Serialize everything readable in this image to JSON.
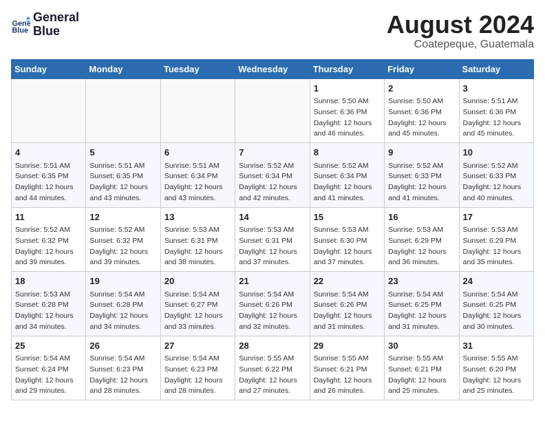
{
  "logo": {
    "line1": "General",
    "line2": "Blue"
  },
  "title": {
    "month_year": "August 2024",
    "location": "Coatepeque, Guatemala"
  },
  "days_of_week": [
    "Sunday",
    "Monday",
    "Tuesday",
    "Wednesday",
    "Thursday",
    "Friday",
    "Saturday"
  ],
  "weeks": [
    [
      {
        "day": "",
        "content": ""
      },
      {
        "day": "",
        "content": ""
      },
      {
        "day": "",
        "content": ""
      },
      {
        "day": "",
        "content": ""
      },
      {
        "day": "1",
        "content": "Sunrise: 5:50 AM\nSunset: 6:36 PM\nDaylight: 12 hours\nand 46 minutes."
      },
      {
        "day": "2",
        "content": "Sunrise: 5:50 AM\nSunset: 6:36 PM\nDaylight: 12 hours\nand 45 minutes."
      },
      {
        "day": "3",
        "content": "Sunrise: 5:51 AM\nSunset: 6:36 PM\nDaylight: 12 hours\nand 45 minutes."
      }
    ],
    [
      {
        "day": "4",
        "content": "Sunrise: 5:51 AM\nSunset: 6:35 PM\nDaylight: 12 hours\nand 44 minutes."
      },
      {
        "day": "5",
        "content": "Sunrise: 5:51 AM\nSunset: 6:35 PM\nDaylight: 12 hours\nand 43 minutes."
      },
      {
        "day": "6",
        "content": "Sunrise: 5:51 AM\nSunset: 6:34 PM\nDaylight: 12 hours\nand 43 minutes."
      },
      {
        "day": "7",
        "content": "Sunrise: 5:52 AM\nSunset: 6:34 PM\nDaylight: 12 hours\nand 42 minutes."
      },
      {
        "day": "8",
        "content": "Sunrise: 5:52 AM\nSunset: 6:34 PM\nDaylight: 12 hours\nand 41 minutes."
      },
      {
        "day": "9",
        "content": "Sunrise: 5:52 AM\nSunset: 6:33 PM\nDaylight: 12 hours\nand 41 minutes."
      },
      {
        "day": "10",
        "content": "Sunrise: 5:52 AM\nSunset: 6:33 PM\nDaylight: 12 hours\nand 40 minutes."
      }
    ],
    [
      {
        "day": "11",
        "content": "Sunrise: 5:52 AM\nSunset: 6:32 PM\nDaylight: 12 hours\nand 39 minutes."
      },
      {
        "day": "12",
        "content": "Sunrise: 5:52 AM\nSunset: 6:32 PM\nDaylight: 12 hours\nand 39 minutes."
      },
      {
        "day": "13",
        "content": "Sunrise: 5:53 AM\nSunset: 6:31 PM\nDaylight: 12 hours\nand 38 minutes."
      },
      {
        "day": "14",
        "content": "Sunrise: 5:53 AM\nSunset: 6:31 PM\nDaylight: 12 hours\nand 37 minutes."
      },
      {
        "day": "15",
        "content": "Sunrise: 5:53 AM\nSunset: 6:30 PM\nDaylight: 12 hours\nand 37 minutes."
      },
      {
        "day": "16",
        "content": "Sunrise: 5:53 AM\nSunset: 6:29 PM\nDaylight: 12 hours\nand 36 minutes."
      },
      {
        "day": "17",
        "content": "Sunrise: 5:53 AM\nSunset: 6:29 PM\nDaylight: 12 hours\nand 35 minutes."
      }
    ],
    [
      {
        "day": "18",
        "content": "Sunrise: 5:53 AM\nSunset: 6:28 PM\nDaylight: 12 hours\nand 34 minutes."
      },
      {
        "day": "19",
        "content": "Sunrise: 5:54 AM\nSunset: 6:28 PM\nDaylight: 12 hours\nand 34 minutes."
      },
      {
        "day": "20",
        "content": "Sunrise: 5:54 AM\nSunset: 6:27 PM\nDaylight: 12 hours\nand 33 minutes."
      },
      {
        "day": "21",
        "content": "Sunrise: 5:54 AM\nSunset: 6:26 PM\nDaylight: 12 hours\nand 32 minutes."
      },
      {
        "day": "22",
        "content": "Sunrise: 5:54 AM\nSunset: 6:26 PM\nDaylight: 12 hours\nand 31 minutes."
      },
      {
        "day": "23",
        "content": "Sunrise: 5:54 AM\nSunset: 6:25 PM\nDaylight: 12 hours\nand 31 minutes."
      },
      {
        "day": "24",
        "content": "Sunrise: 5:54 AM\nSunset: 6:25 PM\nDaylight: 12 hours\nand 30 minutes."
      }
    ],
    [
      {
        "day": "25",
        "content": "Sunrise: 5:54 AM\nSunset: 6:24 PM\nDaylight: 12 hours\nand 29 minutes."
      },
      {
        "day": "26",
        "content": "Sunrise: 5:54 AM\nSunset: 6:23 PM\nDaylight: 12 hours\nand 28 minutes."
      },
      {
        "day": "27",
        "content": "Sunrise: 5:54 AM\nSunset: 6:23 PM\nDaylight: 12 hours\nand 28 minutes."
      },
      {
        "day": "28",
        "content": "Sunrise: 5:55 AM\nSunset: 6:22 PM\nDaylight: 12 hours\nand 27 minutes."
      },
      {
        "day": "29",
        "content": "Sunrise: 5:55 AM\nSunset: 6:21 PM\nDaylight: 12 hours\nand 26 minutes."
      },
      {
        "day": "30",
        "content": "Sunrise: 5:55 AM\nSunset: 6:21 PM\nDaylight: 12 hours\nand 25 minutes."
      },
      {
        "day": "31",
        "content": "Sunrise: 5:55 AM\nSunset: 6:20 PM\nDaylight: 12 hours\nand 25 minutes."
      }
    ]
  ]
}
